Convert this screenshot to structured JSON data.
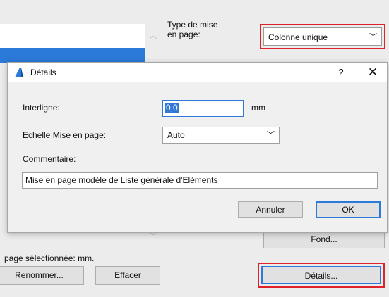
{
  "background": {
    "type_label": "Type de mise\nen page:",
    "type_value": "Colonne unique",
    "fond_button": "Fond...",
    "status_text": "page sélectionnée: mm.",
    "renommer_button": "Renommer...",
    "effacer_button": "Effacer",
    "details_button": "Détails..."
  },
  "dialog": {
    "title": "Détails",
    "help_glyph": "?",
    "close_glyph": "✕",
    "interligne_label": "Interligne:",
    "interligne_value": "0,0",
    "unit_label": "mm",
    "echelle_label": "Echelle Mise en page:",
    "echelle_value": "Auto",
    "commentaire_label": "Commentaire:",
    "commentaire_value": "Mise en page modèle de Liste générale d'Eléments",
    "annuler_button": "Annuler",
    "ok_button": "OK"
  },
  "icons": {
    "app": "archicad-icon",
    "chevron": "chevron-down-icon",
    "scroll_up": "scroll-up-icon",
    "scroll_down": "scroll-down-icon"
  },
  "colors": {
    "accent_blue": "#2b79d8",
    "highlight_red": "#e0232b"
  }
}
